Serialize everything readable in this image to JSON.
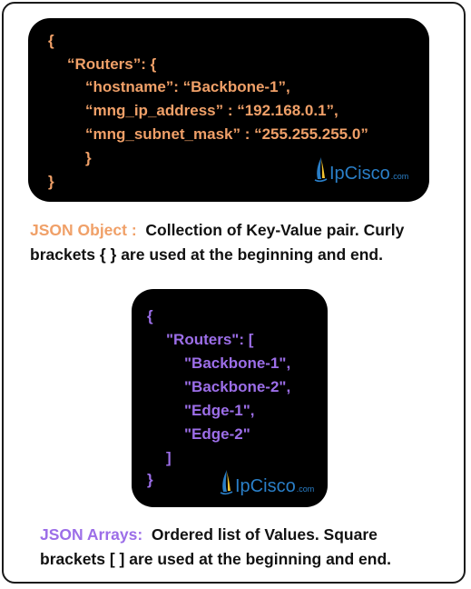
{
  "object_example": {
    "lines": [
      "{",
      "“Routers”: {",
      "“hostname”: “Backbone-1”,",
      "“mng_ip_address” : “192.168.0.1”,",
      "“mng_subnet_mask” : “255.255.255.0”",
      "}",
      "}"
    ],
    "color": "#f0a068"
  },
  "array_example": {
    "lines": [
      "{",
      "\"Routers\": [",
      "\"Backbone-1\",",
      "\"Backbone-2\",",
      "\"Edge-1\",",
      "\"Edge-2\"",
      "]",
      "}"
    ],
    "color": "#9c6ee8"
  },
  "logo": {
    "brand": "IpCisco",
    "suffix": ".com",
    "color": "#2a7fc8"
  },
  "object_description": {
    "label": "JSON Object :",
    "line1": "Collection of Key-Value pair. Curly",
    "line2": "brackets { } are used at the beginning and end."
  },
  "array_description": {
    "label": "JSON Arrays:",
    "line1": "Ordered list of Values. Square",
    "line2": "brackets [ ] are used at the beginning and end."
  }
}
